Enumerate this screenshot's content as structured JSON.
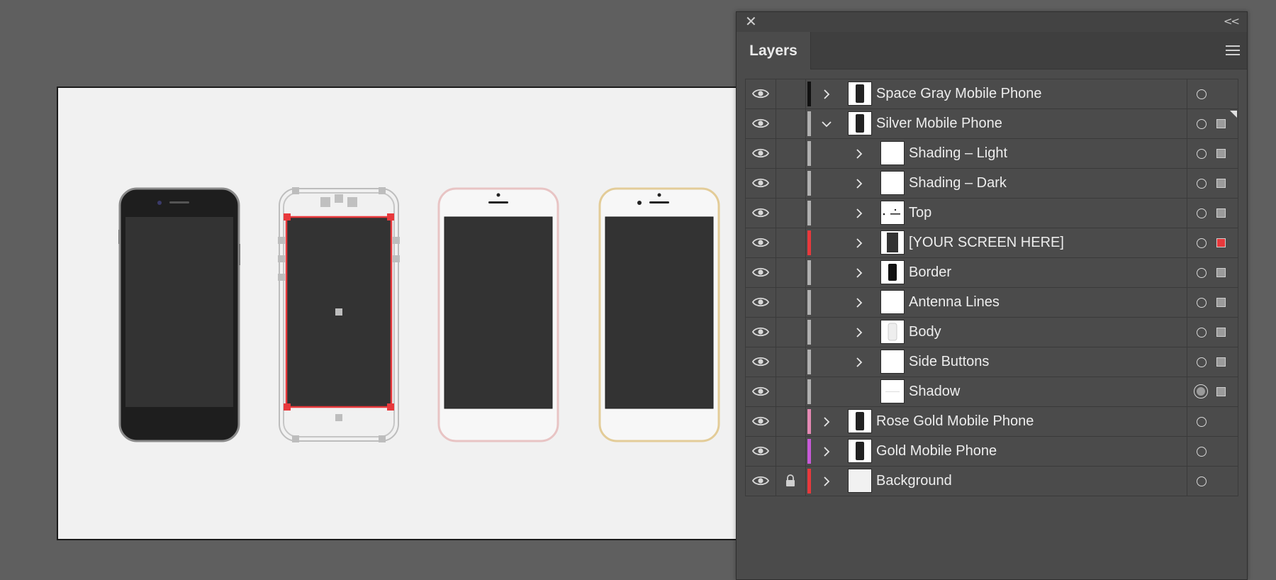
{
  "panel": {
    "close_icon": "close-icon",
    "collapse_icon": "double-chevron-left-icon",
    "menu_icon": "hamburger-menu-icon",
    "tabs": [
      {
        "label": "Layers"
      }
    ]
  },
  "colors": {
    "space_gray": "#111111",
    "silver": "#b0b0b0",
    "screen_layer": "#e8393c",
    "rose_gold": "#e58ab4",
    "gold": "#c85ad8",
    "background_layer": "#e8393c"
  },
  "layers": [
    {
      "name": "Space Gray Mobile Phone",
      "level": 0,
      "expander": "collapsed",
      "color": "#111111",
      "locked": false,
      "visible": true,
      "selected_box": null,
      "target": "normal",
      "thumb": "phone-dark"
    },
    {
      "name": "Silver Mobile Phone",
      "level": 0,
      "expander": "expanded",
      "color": "#b0b0b0",
      "locked": false,
      "visible": true,
      "selected_box": "#9b9b9b",
      "target": "normal",
      "thumb": "phone-dark",
      "corner_marker": true
    },
    {
      "name": "Shading – Light",
      "level": 1,
      "expander": "collapsed",
      "color": "#b0b0b0",
      "locked": false,
      "visible": true,
      "selected_box": "#9b9b9b",
      "target": "normal",
      "thumb": "blank"
    },
    {
      "name": "Shading – Dark",
      "level": 1,
      "expander": "collapsed",
      "color": "#b0b0b0",
      "locked": false,
      "visible": true,
      "selected_box": "#9b9b9b",
      "target": "normal",
      "thumb": "blank"
    },
    {
      "name": "Top",
      "level": 1,
      "expander": "collapsed",
      "color": "#b0b0b0",
      "locked": false,
      "visible": true,
      "selected_box": "#9b9b9b",
      "target": "normal",
      "thumb": "top"
    },
    {
      "name": "[YOUR SCREEN HERE]",
      "level": 1,
      "expander": "collapsed",
      "color": "#e8393c",
      "locked": false,
      "visible": true,
      "selected_box": "#e8393c",
      "target": "normal",
      "thumb": "screen"
    },
    {
      "name": "Border",
      "level": 1,
      "expander": "collapsed",
      "color": "#b0b0b0",
      "locked": false,
      "visible": true,
      "selected_box": "#9b9b9b",
      "target": "normal",
      "thumb": "border"
    },
    {
      "name": "Antenna Lines",
      "level": 1,
      "expander": "collapsed",
      "color": "#b0b0b0",
      "locked": false,
      "visible": true,
      "selected_box": "#9b9b9b",
      "target": "normal",
      "thumb": "blank"
    },
    {
      "name": "Body",
      "level": 1,
      "expander": "collapsed",
      "color": "#b0b0b0",
      "locked": false,
      "visible": true,
      "selected_box": "#9b9b9b",
      "target": "normal",
      "thumb": "body"
    },
    {
      "name": "Side Buttons",
      "level": 1,
      "expander": "collapsed",
      "color": "#b0b0b0",
      "locked": false,
      "visible": true,
      "selected_box": "#9b9b9b",
      "target": "normal",
      "thumb": "blank"
    },
    {
      "name": "Shadow",
      "level": 1,
      "expander": "none",
      "color": "#b0b0b0",
      "locked": false,
      "visible": true,
      "selected_box": "#9b9b9b",
      "target": "active",
      "thumb": "shadow"
    },
    {
      "name": "Rose Gold Mobile Phone",
      "level": 0,
      "expander": "collapsed",
      "color": "#e58ab4",
      "locked": false,
      "visible": true,
      "selected_box": null,
      "target": "normal",
      "thumb": "phone-dark"
    },
    {
      "name": "Gold Mobile Phone",
      "level": 0,
      "expander": "collapsed",
      "color": "#c85ad8",
      "locked": false,
      "visible": true,
      "selected_box": null,
      "target": "normal",
      "thumb": "phone-dark"
    },
    {
      "name": "Background",
      "level": 0,
      "expander": "collapsed",
      "color": "#e8393c",
      "locked": true,
      "visible": true,
      "selected_box": null,
      "target": "normal",
      "thumb": "background"
    }
  ],
  "canvas": {
    "phones": [
      {
        "variant": "space-gray",
        "body": "#2b2b2b",
        "frame": "#8a8a8a",
        "screen": "#333333"
      },
      {
        "variant": "silver-selected",
        "body": "#f1f1f1",
        "frame": "#bdbdbd",
        "screen": "#333333",
        "selection": "#e8393c"
      },
      {
        "variant": "rose-gold",
        "body": "#f7f7f7",
        "frame": "#e8c4c4",
        "screen": "#333333"
      },
      {
        "variant": "gold",
        "body": "#f7f7f7",
        "frame": "#e3cc98",
        "screen": "#333333"
      }
    ]
  }
}
